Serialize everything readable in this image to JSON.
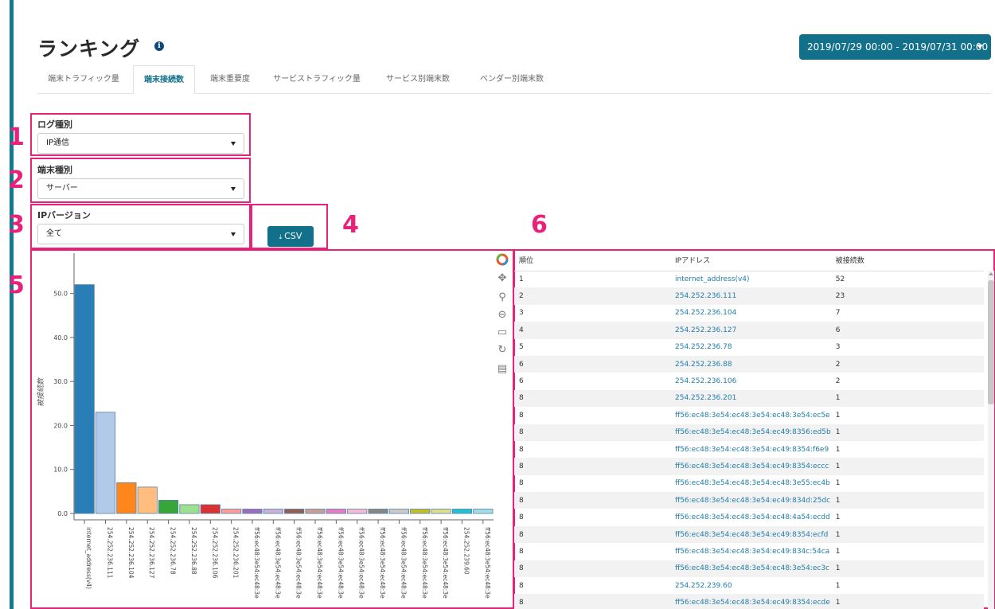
{
  "page": {
    "title": "ランキング",
    "info_icon": "info-icon",
    "date_range": "2019/07/29 00:00 - 2019/07/31 00:00"
  },
  "tabs": [
    {
      "label": "端末トラフィック量",
      "active": false
    },
    {
      "label": "端末接続数",
      "active": true
    },
    {
      "label": "端末重要度",
      "active": false
    },
    {
      "label": "サービストラフィック量",
      "active": false
    },
    {
      "label": "サービス別端末数",
      "active": false
    },
    {
      "label": "ベンダー別端末数",
      "active": false
    }
  ],
  "annotations": [
    "1",
    "2",
    "3",
    "4",
    "5",
    "6"
  ],
  "filters": {
    "log_type": {
      "label": "ログ種別",
      "value": "IP通信"
    },
    "device_type": {
      "label": "端末種別",
      "value": "サーバー"
    },
    "ip_version": {
      "label": "IPバージョン",
      "value": "全て"
    }
  },
  "csv_button": {
    "label": "CSV",
    "icon": "download-icon"
  },
  "toolbar": {
    "icons": [
      "bokeh-logo-icon",
      "pan-icon",
      "zoom-icon",
      "wheel-zoom-icon",
      "box-zoom-icon",
      "reset-icon",
      "hover-icon"
    ]
  },
  "colors": {
    "accent": "#13708a",
    "annotation": "#e8217a",
    "link": "#1f7da8"
  },
  "chart_data": {
    "type": "bar",
    "ylabel": "被接続数",
    "ylim": [
      0,
      55
    ],
    "yticks": [
      "0.0",
      "10.0",
      "20.0",
      "30.0",
      "40.0",
      "50.0"
    ],
    "categories": [
      "internet_address(v4)",
      "254.252.236.111",
      "254.252.236.104",
      "254.252.236.127",
      "254.252.236.78",
      "254.252.236.88",
      "254.252.236.106",
      "254.252.236.201",
      "ff56:ec48:3e54:ec48:3e",
      "ff56:ec48:3e54:ec48:3e",
      "ff56:ec48:3e54:ec48:3e",
      "ff56:ec48:3e54:ec48:3e",
      "ff56:ec48:3e54:ec48:3e",
      "ff56:ec48:3e54:ec48:3e",
      "ff56:ec48:3e54:ec48:3e",
      "ff56:ec48:3e54:ec48:3e",
      "ff56:ec48:3e54:ec48:3e",
      "ff56:ec48:3e54:ec48:3e",
      "254.252.239.60",
      "ff56:ec48:3e54:ec48:3e"
    ],
    "values": [
      52,
      23,
      7,
      6,
      3,
      2,
      2,
      1,
      1,
      1,
      1,
      1,
      1,
      1,
      1,
      1,
      1,
      1,
      1,
      1
    ],
    "colors": [
      "#1f77b4",
      "#aec7e8",
      "#ff7f0e",
      "#ffbb78",
      "#2ca02c",
      "#98df8a",
      "#d62728",
      "#ff9896",
      "#9467bd",
      "#c5b0d5",
      "#8c564b",
      "#c49c94",
      "#e377c2",
      "#f7b6d2",
      "#7f7f7f",
      "#c7c7c7",
      "#bcbd22",
      "#dbdb8d",
      "#17becf",
      "#9edae5"
    ]
  },
  "table": {
    "headers": [
      "順位",
      "IPアドレス",
      "被接続数"
    ],
    "rows": [
      [
        "1",
        "internet_address(v4)",
        "52"
      ],
      [
        "2",
        "254.252.236.111",
        "23"
      ],
      [
        "3",
        "254.252.236.104",
        "7"
      ],
      [
        "4",
        "254.252.236.127",
        "6"
      ],
      [
        "5",
        "254.252.236.78",
        "3"
      ],
      [
        "6",
        "254.252.236.88",
        "2"
      ],
      [
        "6",
        "254.252.236.106",
        "2"
      ],
      [
        "8",
        "254.252.236.201",
        "1"
      ],
      [
        "8",
        "ff56:ec48:3e54:ec48:3e54:ec48:3e54:ec5e",
        "1"
      ],
      [
        "8",
        "ff56:ec48:3e54:ec48:3e54:ec49:8356:ed5b",
        "1"
      ],
      [
        "8",
        "ff56:ec48:3e54:ec48:3e54:ec49:8354:f6e9",
        "1"
      ],
      [
        "8",
        "ff56:ec48:3e54:ec48:3e54:ec49:8354:eccc",
        "1"
      ],
      [
        "8",
        "ff56:ec48:3e54:ec48:3e54:ec48:3e55:ec4b",
        "1"
      ],
      [
        "8",
        "ff56:ec48:3e54:ec48:3e54:ec49:834d:25dc",
        "1"
      ],
      [
        "8",
        "ff56:ec48:3e54:ec48:3e54:ec48:4a54:ecdd",
        "1"
      ],
      [
        "8",
        "ff56:ec48:3e54:ec48:3e54:ec49:8354:ecfd",
        "1"
      ],
      [
        "8",
        "ff56:ec48:3e54:ec48:3e54:ec49:834c:54ca",
        "1"
      ],
      [
        "8",
        "ff56:ec48:3e54:ec48:3e54:ec48:3e54:ec3c",
        "1"
      ],
      [
        "8",
        "254.252.239.60",
        "1"
      ],
      [
        "8",
        "ff56:ec48:3e54:ec48:3e54:ec49:8354:ecde",
        "1"
      ]
    ]
  }
}
